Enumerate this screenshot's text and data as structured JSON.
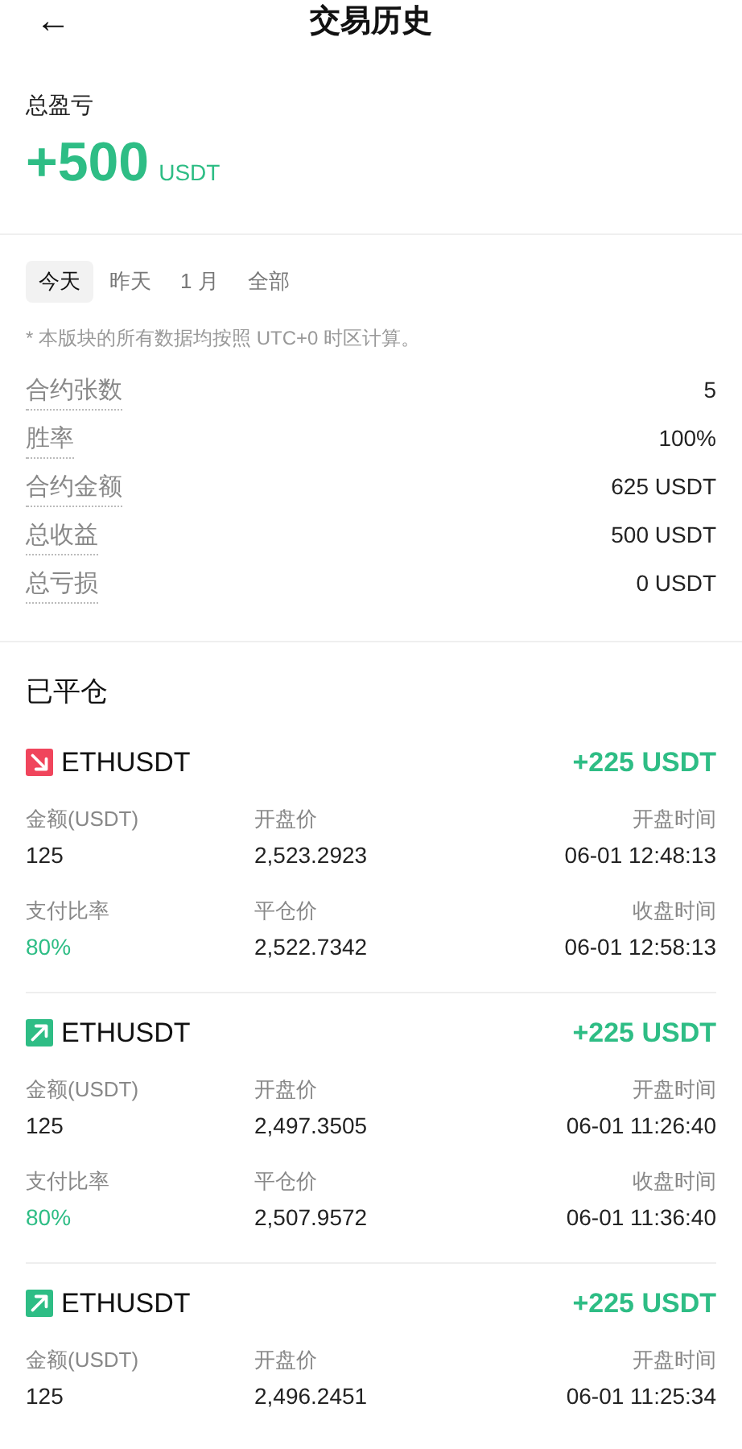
{
  "header": {
    "back": "←",
    "title": "交易历史"
  },
  "summary": {
    "label": "总盈亏",
    "amount": "+500",
    "unit": "USDT"
  },
  "tabs": [
    {
      "label": "今天",
      "selected": true
    },
    {
      "label": "昨天",
      "selected": false
    },
    {
      "label": "1 月",
      "selected": false
    },
    {
      "label": "全部",
      "selected": false
    }
  ],
  "note": "* 本版块的所有数据均按照 UTC+0 时区计算。",
  "stats": [
    {
      "label": "合约张数",
      "value": "5"
    },
    {
      "label": "胜率",
      "value": "100%"
    },
    {
      "label": "合约金额",
      "value": "625 USDT"
    },
    {
      "label": "总收益",
      "value": "500 USDT"
    },
    {
      "label": "总亏损",
      "value": "0 USDT"
    }
  ],
  "closed": {
    "title": "已平仓",
    "trades": [
      {
        "kind": "down",
        "symbol": "ETHUSDT",
        "profit": "+225 USDT",
        "rows": [
          [
            {
              "label": "金额(USDT)",
              "value": "125",
              "accent": false
            },
            {
              "label": "开盘价",
              "value": "2,523.2923",
              "accent": false
            },
            {
              "label": "开盘时间",
              "value": "06-01 12:48:13",
              "accent": false
            }
          ],
          [
            {
              "label": "支付比率",
              "value": "80%",
              "accent": true
            },
            {
              "label": "平仓价",
              "value": "2,522.7342",
              "accent": false
            },
            {
              "label": "收盘时间",
              "value": "06-01 12:58:13",
              "accent": false
            }
          ]
        ]
      },
      {
        "kind": "up",
        "symbol": "ETHUSDT",
        "profit": "+225 USDT",
        "rows": [
          [
            {
              "label": "金额(USDT)",
              "value": "125",
              "accent": false
            },
            {
              "label": "开盘价",
              "value": "2,497.3505",
              "accent": false
            },
            {
              "label": "开盘时间",
              "value": "06-01 11:26:40",
              "accent": false
            }
          ],
          [
            {
              "label": "支付比率",
              "value": "80%",
              "accent": true
            },
            {
              "label": "平仓价",
              "value": "2,507.9572",
              "accent": false
            },
            {
              "label": "收盘时间",
              "value": "06-01 11:36:40",
              "accent": false
            }
          ]
        ]
      },
      {
        "kind": "up",
        "symbol": "ETHUSDT",
        "profit": "+225 USDT",
        "rows": [
          [
            {
              "label": "金额(USDT)",
              "value": "125",
              "accent": false
            },
            {
              "label": "开盘价",
              "value": "2,496.2451",
              "accent": false
            },
            {
              "label": "开盘时间",
              "value": "06-01 11:25:34",
              "accent": false
            }
          ]
        ]
      }
    ]
  }
}
